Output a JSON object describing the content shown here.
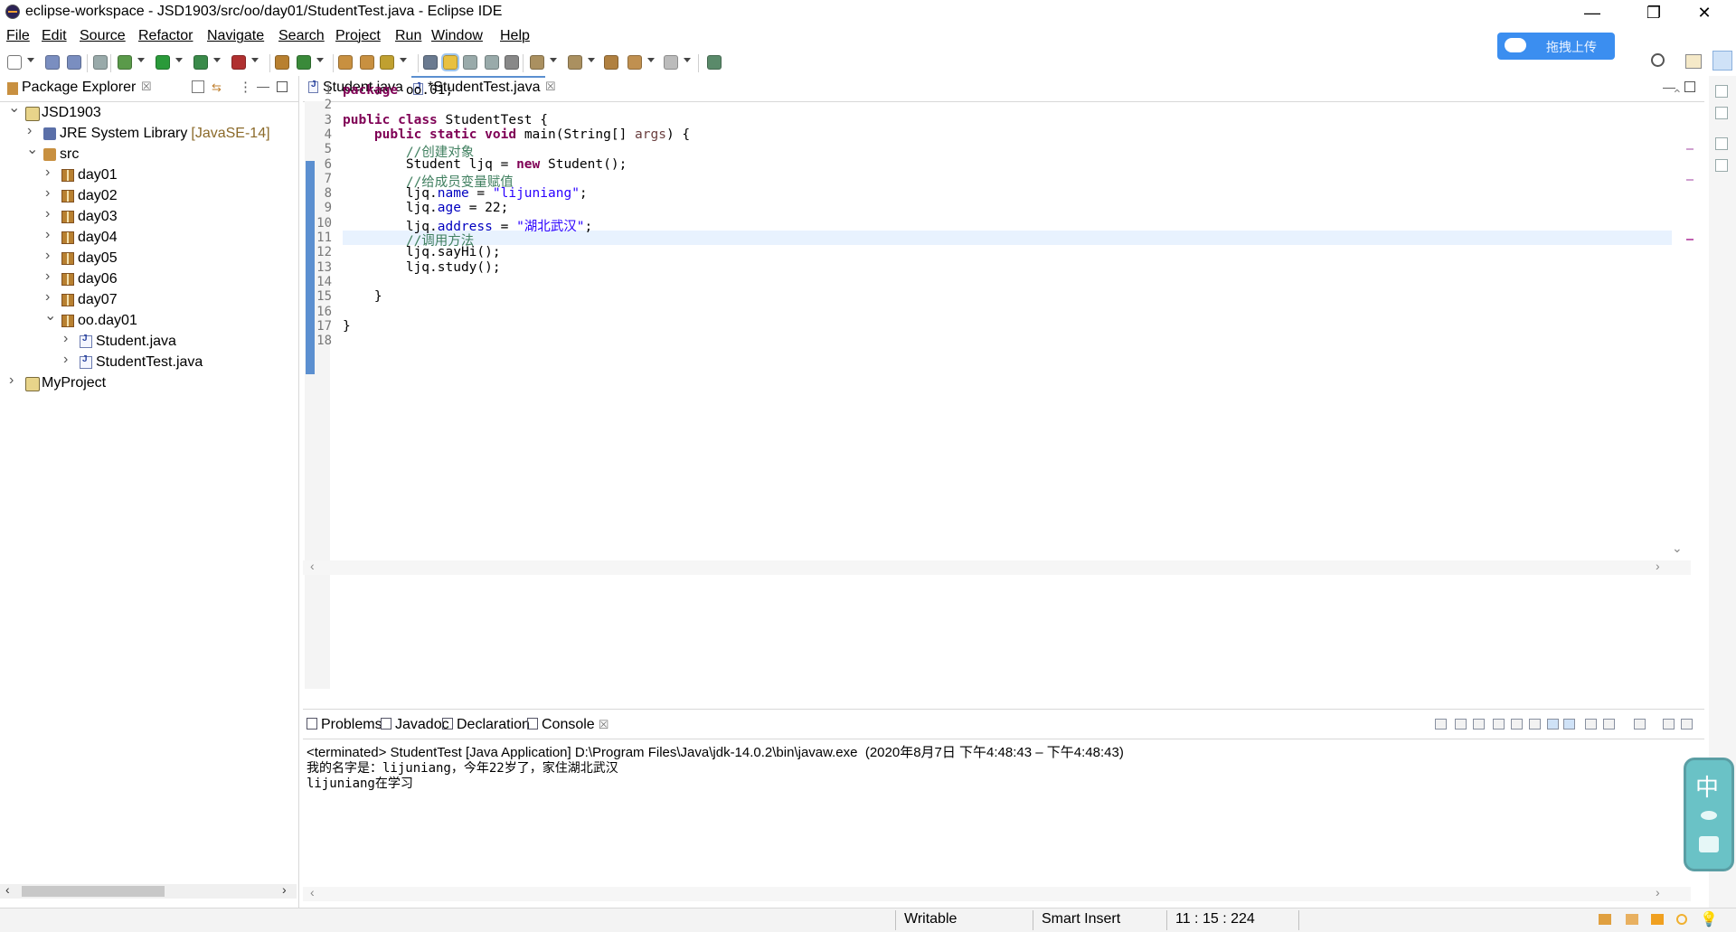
{
  "window": {
    "title": "eclipse-workspace - JSD1903/src/oo/day01/StudentTest.java - Eclipse IDE",
    "minimize": "—",
    "restore": "❐",
    "close": "✕"
  },
  "menu": [
    {
      "label": "File",
      "mnemonic": "F",
      "rest": "ile"
    },
    {
      "label": "Edit",
      "mnemonic": "E",
      "rest": "dit"
    },
    {
      "label": "Source",
      "mnemonic": "S",
      "rest": "ource"
    },
    {
      "label": "Refactor",
      "mnemonic": "",
      "rest": "Refactor"
    },
    {
      "label": "Navigate",
      "mnemonic": "N",
      "rest": "avigate"
    },
    {
      "label": "Search",
      "mnemonic": "",
      "rest": "Search"
    },
    {
      "label": "Project",
      "mnemonic": "P",
      "rest": "roject"
    },
    {
      "label": "Run",
      "mnemonic": "R",
      "rest": "un"
    },
    {
      "label": "Window",
      "mnemonic": "W",
      "rest": "indow"
    },
    {
      "label": "Help",
      "mnemonic": "H",
      "rest": "elp"
    }
  ],
  "upload_button": {
    "label": "拖拽上传"
  },
  "package_explorer": {
    "tab_label": "Package Explorer",
    "tree": [
      {
        "label": "JSD1903",
        "decoration": "",
        "icon": "project-icon",
        "expanded": true
      },
      {
        "label": "JRE System Library",
        "decoration": "[JavaSE-14]",
        "icon": "library-icon",
        "expanded": false
      },
      {
        "label": "src",
        "decoration": "",
        "icon": "source-folder-icon",
        "expanded": true
      },
      {
        "label": "day01",
        "decoration": "",
        "icon": "package-icon",
        "expanded": false
      },
      {
        "label": "day02",
        "decoration": "",
        "icon": "package-icon",
        "expanded": false
      },
      {
        "label": "day03",
        "decoration": "",
        "icon": "package-icon",
        "expanded": false
      },
      {
        "label": "day04",
        "decoration": "",
        "icon": "package-icon",
        "expanded": false
      },
      {
        "label": "day05",
        "decoration": "",
        "icon": "package-icon",
        "expanded": false
      },
      {
        "label": "day06",
        "decoration": "",
        "icon": "package-icon",
        "expanded": false
      },
      {
        "label": "day07",
        "decoration": "",
        "icon": "package-icon",
        "expanded": false
      },
      {
        "label": "oo.day01",
        "decoration": "",
        "icon": "package-icon",
        "expanded": true
      },
      {
        "label": "Student.java",
        "decoration": "",
        "icon": "java-file-icon",
        "expanded": false
      },
      {
        "label": "StudentTest.java",
        "decoration": "",
        "icon": "java-file-icon",
        "expanded": false
      },
      {
        "label": "MyProject",
        "decoration": "",
        "icon": "project-icon",
        "expanded": false
      }
    ]
  },
  "editor": {
    "tabs": [
      {
        "label": "Student.java",
        "active": false
      },
      {
        "label": "*StudentTest.java",
        "active": true
      }
    ],
    "current_line": 11,
    "lines": [
      "package oo.day01;",
      "",
      "public class StudentTest {",
      "    public static void main(String[] args) {",
      "        //创建对象",
      "        Student ljq = new Student();",
      "        //给成员变量赋值",
      "        ljq.name = \"lijuniang\";",
      "        ljq.age = 22;",
      "        ljq.address = \"湖北武汉\";",
      "        //调用方法",
      "        ljq.sayHi();",
      "        ljq.study();",
      "",
      "    }",
      "",
      "}",
      ""
    ]
  },
  "bottom_panel": {
    "tabs": [
      {
        "label": "Problems",
        "icon": "problems-icon"
      },
      {
        "label": "Javadoc",
        "icon": "javadoc-icon"
      },
      {
        "label": "Declaration",
        "icon": "declaration-icon"
      },
      {
        "label": "Console",
        "icon": "console-icon"
      }
    ],
    "console_header": "<terminated> StudentTest [Java Application] D:\\Program Files\\Java\\jdk-14.0.2\\bin\\javaw.exe  (2020年8月7日 下午4:48:43 – 下午4:48:43)",
    "console_output": [
      "我的名字是：lijuniang，今年22岁了，家住湖北武汉",
      "lijuniang在学习"
    ]
  },
  "status_bar": {
    "writable": "Writable",
    "insert_mode": "Smart Insert",
    "position": "11 : 15 : 224"
  },
  "ime": {
    "label": "中"
  }
}
